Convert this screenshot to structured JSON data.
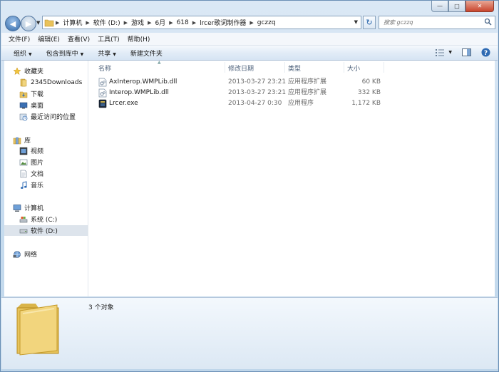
{
  "window": {
    "buttons": {
      "minimize": "—",
      "maximize": "□",
      "close": "✕"
    }
  },
  "address": {
    "crumbs": [
      "计算机",
      "软件 (D:)",
      "游戏",
      "6月",
      "618",
      "lrcer歌词制作器",
      "gczzq"
    ],
    "search_placeholder": "搜索 gczzq"
  },
  "menu": {
    "file": "文件(F)",
    "edit": "编辑(E)",
    "view": "查看(V)",
    "tools": "工具(T)",
    "help": "帮助(H)"
  },
  "toolbar": {
    "organize": "组织",
    "include_library": "包含到库中",
    "share": "共享",
    "new_folder": "新建文件夹"
  },
  "nav": {
    "favorites": "收藏夹",
    "downloads2345": "2345Downloads",
    "downloads": "下载",
    "desktop": "桌面",
    "recent": "最近访问的位置",
    "libraries": "库",
    "videos": "视频",
    "pictures": "图片",
    "documents": "文档",
    "music": "音乐",
    "computer": "计算机",
    "drive_c": "系统 (C:)",
    "drive_d": "软件 (D:)",
    "network": "网络"
  },
  "columns": {
    "name": "名称",
    "modified": "修改日期",
    "type": "类型",
    "size": "大小"
  },
  "files": [
    {
      "name": "AxInterop.WMPLib.dll",
      "modified": "2013-03-27 23:21",
      "type": "应用程序扩展",
      "size": "60 KB",
      "icon": "dll-icon"
    },
    {
      "name": "Interop.WMPLib.dll",
      "modified": "2013-03-27 23:21",
      "type": "应用程序扩展",
      "size": "332 KB",
      "icon": "dll-icon"
    },
    {
      "name": "Lrcer.exe",
      "modified": "2013-04-27 0:30",
      "type": "应用程序",
      "size": "1,172 KB",
      "icon": "exe-icon"
    }
  ],
  "status": {
    "count": "3 个对象"
  },
  "colors": {
    "accent": "#3a72b8",
    "selected_nav": "#dde4ec"
  }
}
